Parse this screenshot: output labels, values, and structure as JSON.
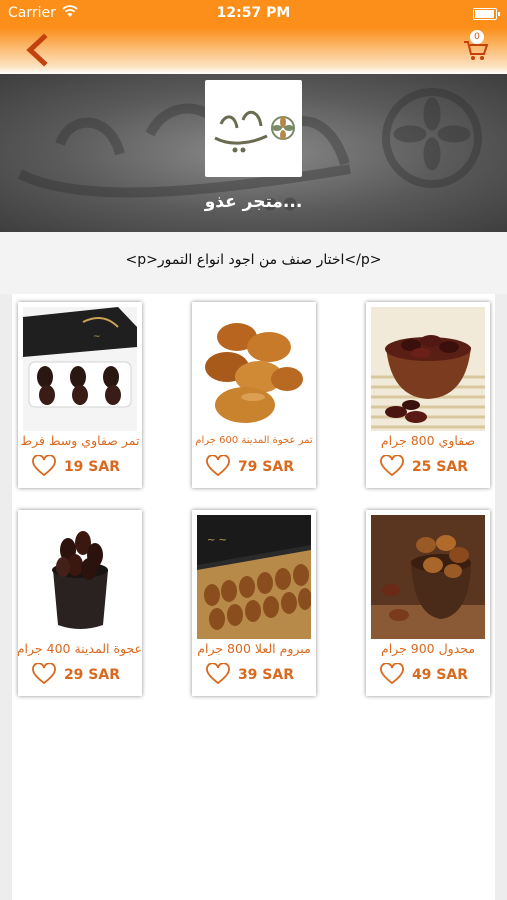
{
  "status_bar": {
    "carrier": "Carrier",
    "time": "12:57 PM"
  },
  "nav": {
    "back_icon": "chevron-left-icon",
    "cart_icon": "cart-icon",
    "cart_count": "0"
  },
  "store": {
    "name": "متجر عذو...",
    "logo_text": "عذق طيبة",
    "banner_text": "عذق طيبة",
    "description": "<p>اختار صنف من اجود انواع التمور</p>"
  },
  "products": [
    {
      "name": "صفاوي 800 جرام",
      "price": "25 SAR",
      "image": "dates-bowl-wood"
    },
    {
      "name": "تمر عجوة المدينة 600 جرام",
      "price": "79 SAR",
      "image": "golden-dates"
    },
    {
      "name": "تمر صفاوي وسط فرط",
      "price": "19 SAR",
      "image": "dates-gift-box"
    },
    {
      "name": "مجدول 900 جرام",
      "price": "49 SAR",
      "image": "medjool-bowl"
    },
    {
      "name": "مبروم العلا 800 جرام",
      "price": "39 SAR",
      "image": "dates-box-open"
    },
    {
      "name": "عجوة المدينة 400 جرام",
      "price": "29 SAR",
      "image": "ajwa-bowl"
    }
  ],
  "colors": {
    "accent": "#fb8f1a",
    "product_text": "#d9691f",
    "banner": "#5a5a5a"
  }
}
